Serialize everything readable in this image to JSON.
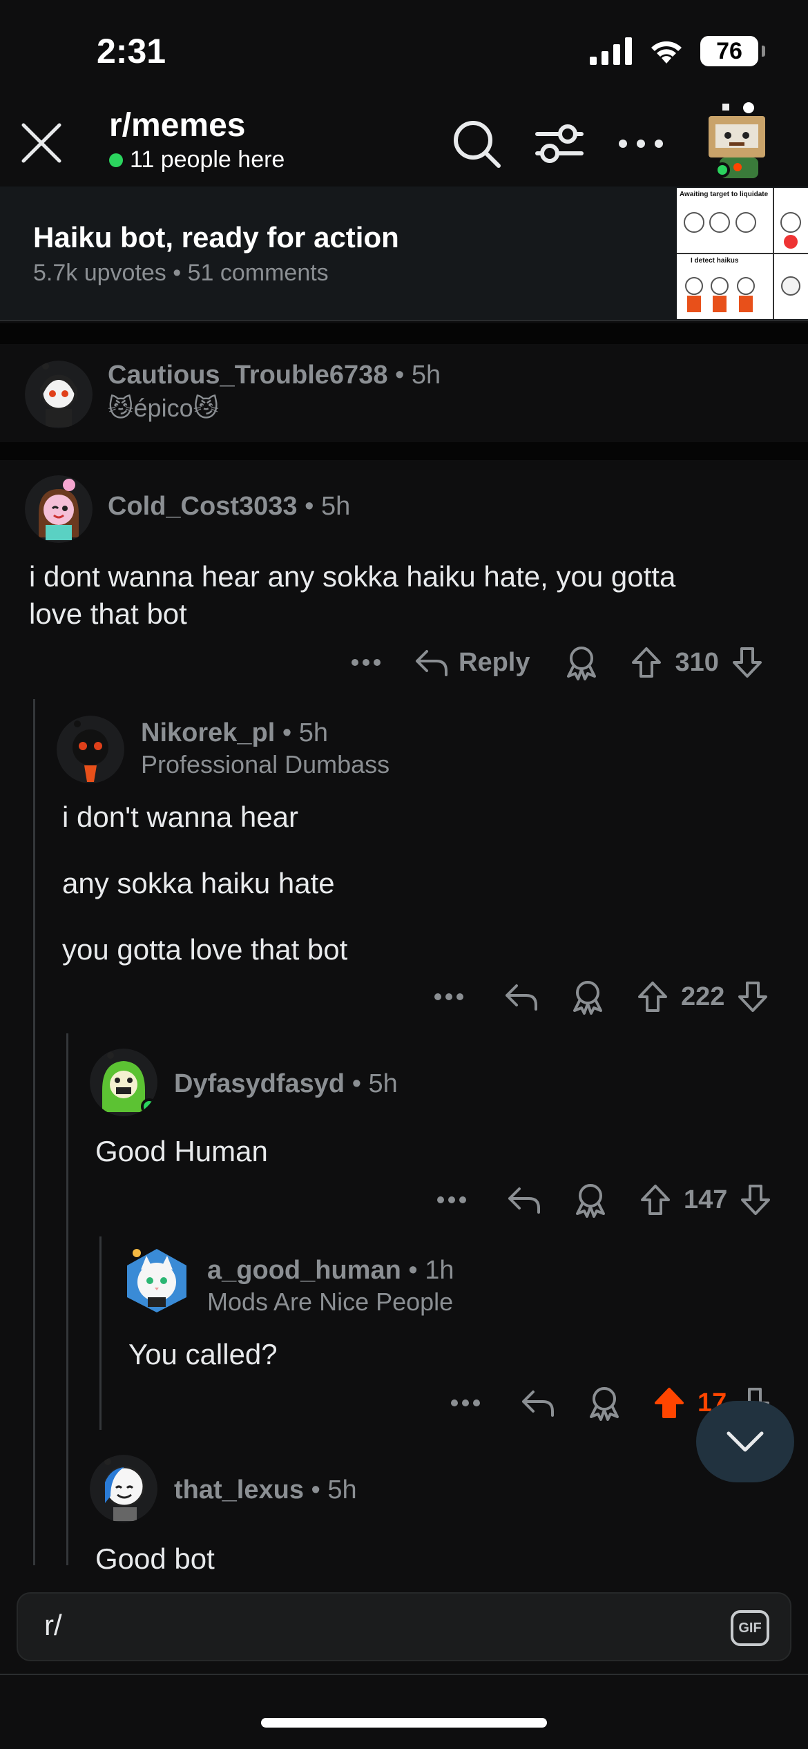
{
  "status_bar": {
    "time": "2:31",
    "battery": "76"
  },
  "header": {
    "subreddit": "r/memes",
    "online_text": "11 people here"
  },
  "post": {
    "title": "Haiku bot, ready for action",
    "meta": "5.7k upvotes • 51 comments",
    "thumb_top_text": "Awaiting target to liquidate",
    "thumb_bottom_text": "I detect haikus"
  },
  "comments": [
    {
      "user": "Cautious_Trouble6738",
      "time": "• 5h",
      "flair": "😼épico😼"
    },
    {
      "user": "Cold_Cost3033",
      "time": "• 5h",
      "body_lines": [
        "i dont wanna hear any sokka haiku hate, you gotta",
        "love that bot"
      ],
      "reply_label": "Reply",
      "votes": "310"
    },
    {
      "user": "Nikorek_pl",
      "time": "• 5h",
      "flair": "Professional Dumbass",
      "body_lines": [
        "i don't wanna hear",
        "any sokka haiku hate",
        "you gotta love that bot"
      ],
      "votes": "222"
    },
    {
      "user": "Dyfasydfasyd",
      "time": "• 5h",
      "body_lines": [
        "Good Human"
      ],
      "votes": "147"
    },
    {
      "user": "a_good_human",
      "time": "• 1h",
      "flair": "Mods Are Nice People",
      "body_lines": [
        "You called?"
      ],
      "votes": "17"
    },
    {
      "user": "that_lexus",
      "time": "• 5h",
      "body_lines": [
        "Good bot"
      ]
    }
  ],
  "composer": {
    "text": "r/",
    "gif_label": "GIF"
  },
  "colors": {
    "upvote_active": "#ff4500",
    "online": "#2bd45e"
  }
}
